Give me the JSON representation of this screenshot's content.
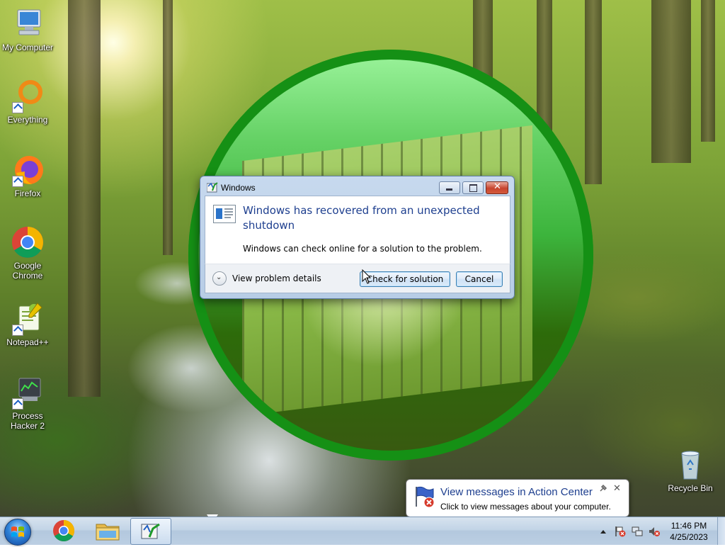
{
  "desktop": {
    "icons": [
      {
        "label": "My Computer",
        "icon": "computer-icon"
      },
      {
        "label": "Everything",
        "icon": "everything-search-icon"
      },
      {
        "label": "Firefox",
        "icon": "firefox-icon"
      },
      {
        "label": "Google Chrome",
        "icon": "chrome-icon"
      },
      {
        "label": "Notepad++",
        "icon": "notepad-plus-plus-icon"
      },
      {
        "label": "Process Hacker 2",
        "icon": "process-hacker-icon"
      },
      {
        "label": "Recycle Bin",
        "icon": "recycle-bin-icon"
      }
    ]
  },
  "dialog": {
    "title": "Windows",
    "headline": "Windows has recovered from an unexpected shutdown",
    "message": "Windows can check online for a solution to the problem.",
    "details_label": "View problem details",
    "check_button": "Check for solution",
    "cancel_button": "Cancel"
  },
  "notification": {
    "title": "View messages in Action Center",
    "text": "Click to view messages about your computer."
  },
  "taskbar": {
    "pinned": [
      "start-orb",
      "chrome-icon",
      "explorer-icon",
      "windows-problem-reporting-icon"
    ],
    "clock_time": "11:46 PM",
    "clock_date": "4/25/2023"
  },
  "colors": {
    "dialog_heading": "#1e3f8f",
    "circle_green": "#1a9a1a",
    "taskbar": "#c2d4e6"
  }
}
